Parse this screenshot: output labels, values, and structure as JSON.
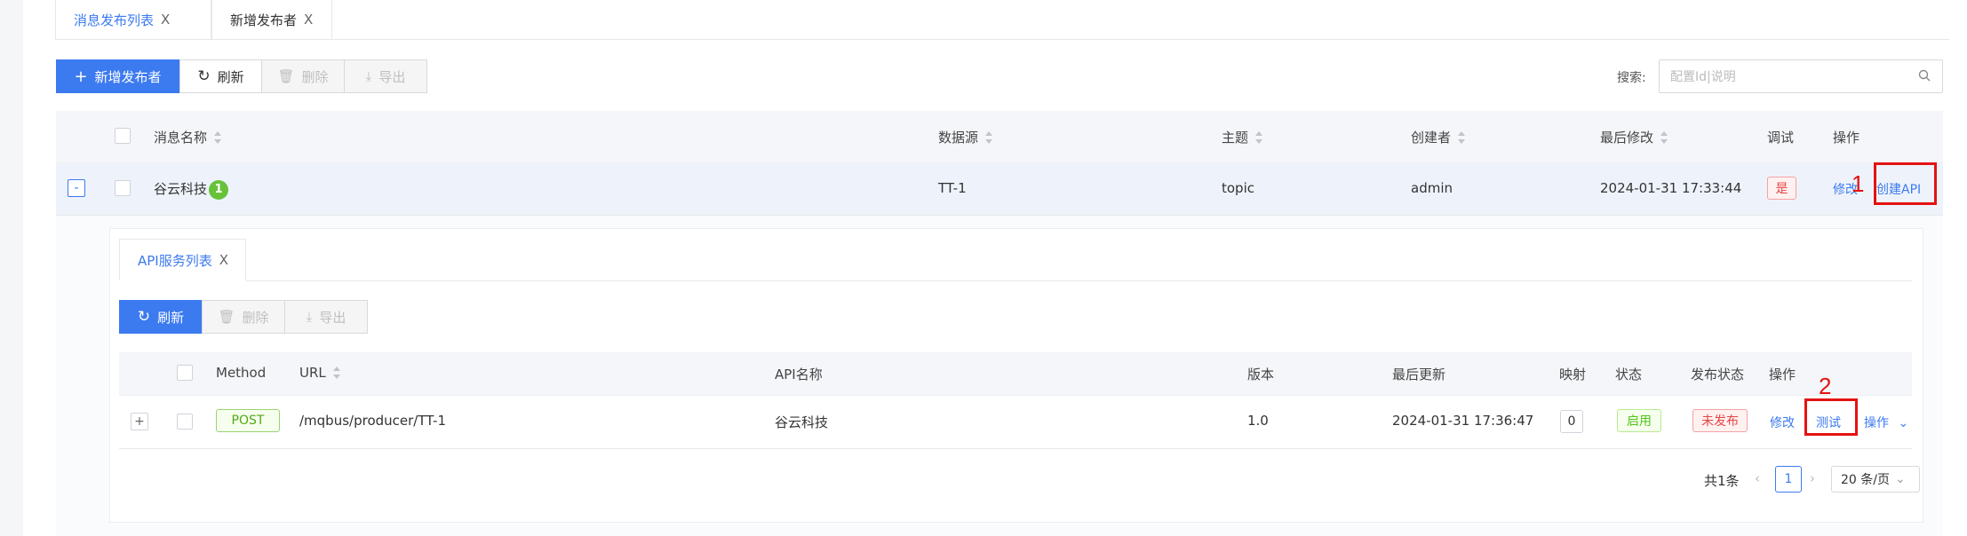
{
  "tabs": [
    {
      "label": "消息发布列表",
      "close": "X",
      "active": true
    },
    {
      "label": "新增发布者",
      "close": "X",
      "active": false
    }
  ],
  "toolbar": {
    "add_label": "新增发布者",
    "add_icon": "plus-icon",
    "refresh_label": "刷新",
    "refresh_icon": "refresh-icon",
    "delete_label": "删除",
    "delete_icon": "trash-icon",
    "export_label": "导出",
    "export_icon": "download-icon",
    "search_label": "搜索:",
    "search_placeholder": "配置Id|说明",
    "search_icon": "search-icon"
  },
  "table": {
    "columns": [
      "消息名称",
      "数据源",
      "主题",
      "创建者",
      "最后修改",
      "调试",
      "操作"
    ],
    "rows": [
      {
        "expand": "-",
        "name": "谷云科技",
        "badge": "1",
        "datasource": "TT-1",
        "topic": "topic",
        "creator": "admin",
        "modified": "2024-01-31 17:33:44",
        "debug": "是",
        "action_edit": "修改",
        "action_create_api": "创建API"
      }
    ]
  },
  "subpanel": {
    "tab_label": "API服务列表",
    "tab_close": "X",
    "refresh_label": "刷新",
    "delete_label": "删除",
    "export_label": "导出",
    "columns": [
      "Method",
      "URL",
      "API名称",
      "版本",
      "最后更新",
      "映射",
      "状态",
      "发布状态",
      "操作"
    ],
    "rows": [
      {
        "expand": "+",
        "method": "POST",
        "url": "/mqbus/producer/TT-1",
        "api_name": "谷云科技",
        "version": "1.0",
        "updated": "2024-01-31 17:36:47",
        "mapping": "0",
        "status": "启用",
        "publish_status": "未发布",
        "action_edit": "修改",
        "action_test": "测试",
        "action_more": "操作",
        "action_more_icon": "chevron-down-icon"
      }
    ],
    "pagination": {
      "total": "共1条",
      "page": "1",
      "page_size": "20 条/页",
      "prev_icon": "chevron-left-icon",
      "next_icon": "chevron-right-icon"
    }
  },
  "annotations": {
    "marker1": "1",
    "marker2": "2"
  },
  "colors": {
    "primary": "#3c7af0",
    "annotation_red": "#e41212",
    "success": "#52c41a",
    "danger": "#e64545"
  }
}
